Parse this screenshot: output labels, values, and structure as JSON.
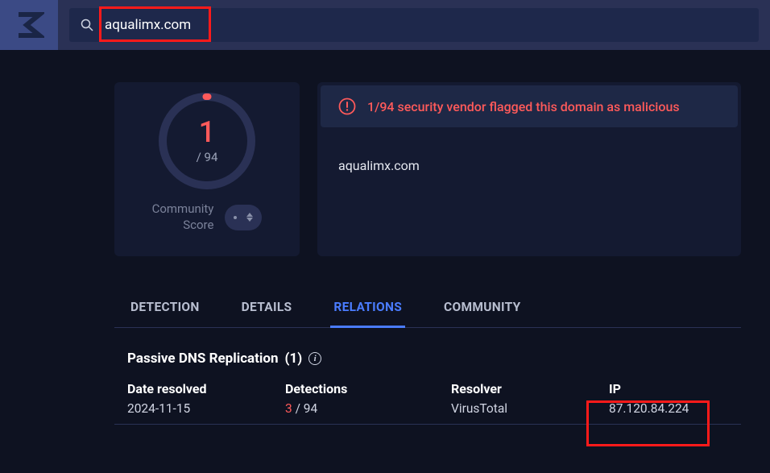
{
  "search": {
    "value": "aqualimx.com"
  },
  "score": {
    "numerator": "1",
    "denominator": "/ 94",
    "community_label_1": "Community",
    "community_label_2": "Score"
  },
  "banner": {
    "text": "1/94 security vendor flagged this domain as malicious"
  },
  "domain": "aqualimx.com",
  "tabs": {
    "detection": "DETECTION",
    "details": "DETAILS",
    "relations": "RELATIONS",
    "community": "COMMUNITY"
  },
  "section": {
    "title": "Passive DNS Replication",
    "count": "(1)"
  },
  "table": {
    "headers": {
      "date": "Date resolved",
      "detections": "Detections",
      "resolver": "Resolver",
      "ip": "IP"
    },
    "row": {
      "date": "2024-11-15",
      "det_num": "3",
      "det_den": " / 94",
      "resolver": "VirusTotal",
      "ip": "87.120.84.224"
    }
  }
}
